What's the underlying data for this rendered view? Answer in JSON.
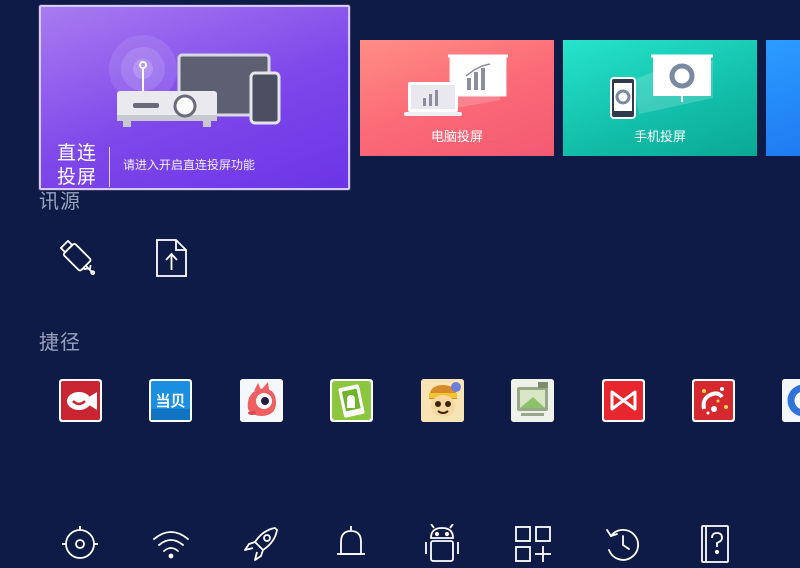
{
  "cards": {
    "direct": {
      "title": "直连投屏",
      "desc": "请进入开启直连投屏功能"
    },
    "pc": {
      "label": "电脑投屏"
    },
    "phone": {
      "label": "手机投屏"
    }
  },
  "sections": {
    "source": {
      "title": "讯源"
    },
    "shortcut": {
      "title": "捷径"
    }
  },
  "source_items": [
    "usb-drive-icon",
    "file-upload-icon"
  ],
  "shortcut_apps": [
    "video-app-icon",
    "dangbei-app-icon",
    "pink-dino-app-icon",
    "android-install-app-icon",
    "monkey-app-icon",
    "tv-box-app-icon",
    "bowtie-app-icon",
    "celebration-app-icon",
    "blue-circle-app-icon"
  ],
  "bottom_tools": [
    "settings-icon",
    "wifi-icon",
    "rocket-icon",
    "bell-icon",
    "android-icon",
    "app-grid-icon",
    "history-icon",
    "help-manual-icon"
  ],
  "colors": {
    "background": "#0d1b46",
    "direct_card": "#7e47ea",
    "pc_card": "#fb6b77",
    "phone_card": "#13c1ac",
    "section_title": "#98a2be"
  }
}
